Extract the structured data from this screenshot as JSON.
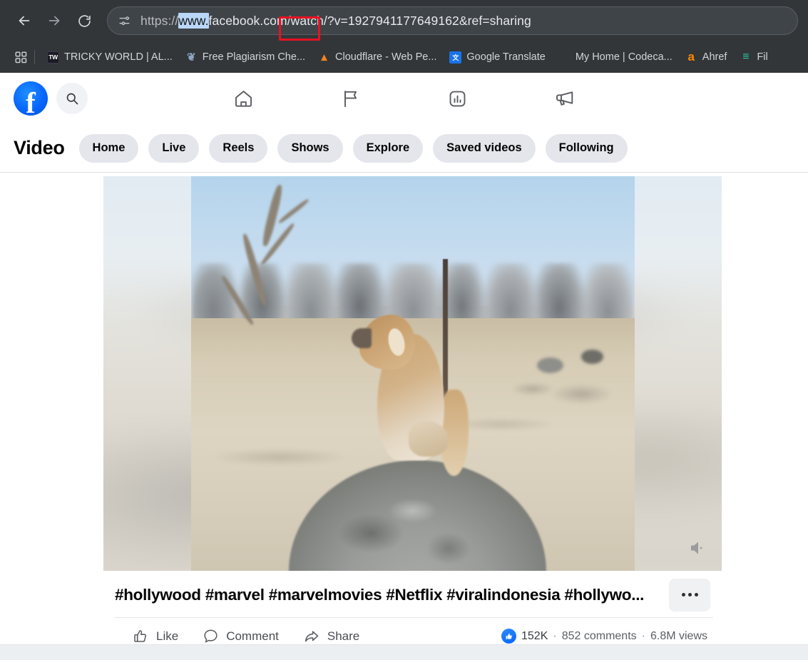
{
  "browser": {
    "nav": {
      "back_label": "Back",
      "forward_label": "Forward",
      "reload_label": "Reload"
    },
    "address_bar": {
      "site_info_icon": "tune-permissions-icon",
      "url_full": "https://www.facebook.com/watch/?v=1927941177649162&ref=sharing",
      "url_scheme": "https://",
      "url_selected": "www.",
      "url_rest": "facebook.com/watch/?v=1927941177649162&ref=sharing",
      "selection_highlight_color": "#b9d7f7",
      "annotation_color": "#e81123"
    },
    "bookmarks": {
      "apps_label": "Apps",
      "items": [
        {
          "label": "TRICKY WORLD | AL...",
          "icon": "tw-favicon",
          "glyph": "TW"
        },
        {
          "label": "Free Plagiarism Che...",
          "icon": "plagiarism-favicon",
          "glyph": "❦"
        },
        {
          "label": "Cloudflare - Web Pe...",
          "icon": "cloudflare-favicon",
          "glyph": "▴"
        },
        {
          "label": "Google Translate",
          "icon": "google-translate-favicon",
          "glyph": "文"
        },
        {
          "label": "My Home | Codeca...",
          "icon": "codecademy-favicon",
          "glyph": ""
        },
        {
          "label": "Ahref",
          "icon": "ahrefs-favicon",
          "glyph": "a"
        },
        {
          "label": "Fil",
          "icon": "file-favicon",
          "glyph": "≡"
        }
      ]
    }
  },
  "facebook": {
    "header": {
      "logo_label": "Facebook",
      "logo_color": "#0866ff",
      "search_placeholder": "Search Facebook",
      "nav_items": [
        {
          "name": "home",
          "icon": "home-icon"
        },
        {
          "name": "pages",
          "icon": "flag-icon"
        },
        {
          "name": "ads-manager",
          "icon": "chart-square-icon"
        },
        {
          "name": "marketing",
          "icon": "megaphone-icon"
        }
      ]
    },
    "video_bar": {
      "title": "Video",
      "tabs": [
        {
          "label": "Home"
        },
        {
          "label": "Live"
        },
        {
          "label": "Reels"
        },
        {
          "label": "Shows"
        },
        {
          "label": "Explore"
        },
        {
          "label": "Saved videos"
        },
        {
          "label": "Following"
        }
      ]
    },
    "post": {
      "caption": "#hollywood #marvel #marvelmovies #Netflix #viralindonesia #hollywo...",
      "more_label": "More options",
      "volume_icon": "speaker-muted-icon",
      "actions": [
        {
          "label": "Like",
          "icon": "thumbs-up-icon"
        },
        {
          "label": "Comment",
          "icon": "comment-bubble-icon"
        },
        {
          "label": "Share",
          "icon": "share-arrow-icon"
        }
      ],
      "stats": {
        "reactions": "152K",
        "separator_1": "·",
        "comments": "852 comments",
        "separator_2": "·",
        "views": "6.8M views"
      }
    }
  }
}
